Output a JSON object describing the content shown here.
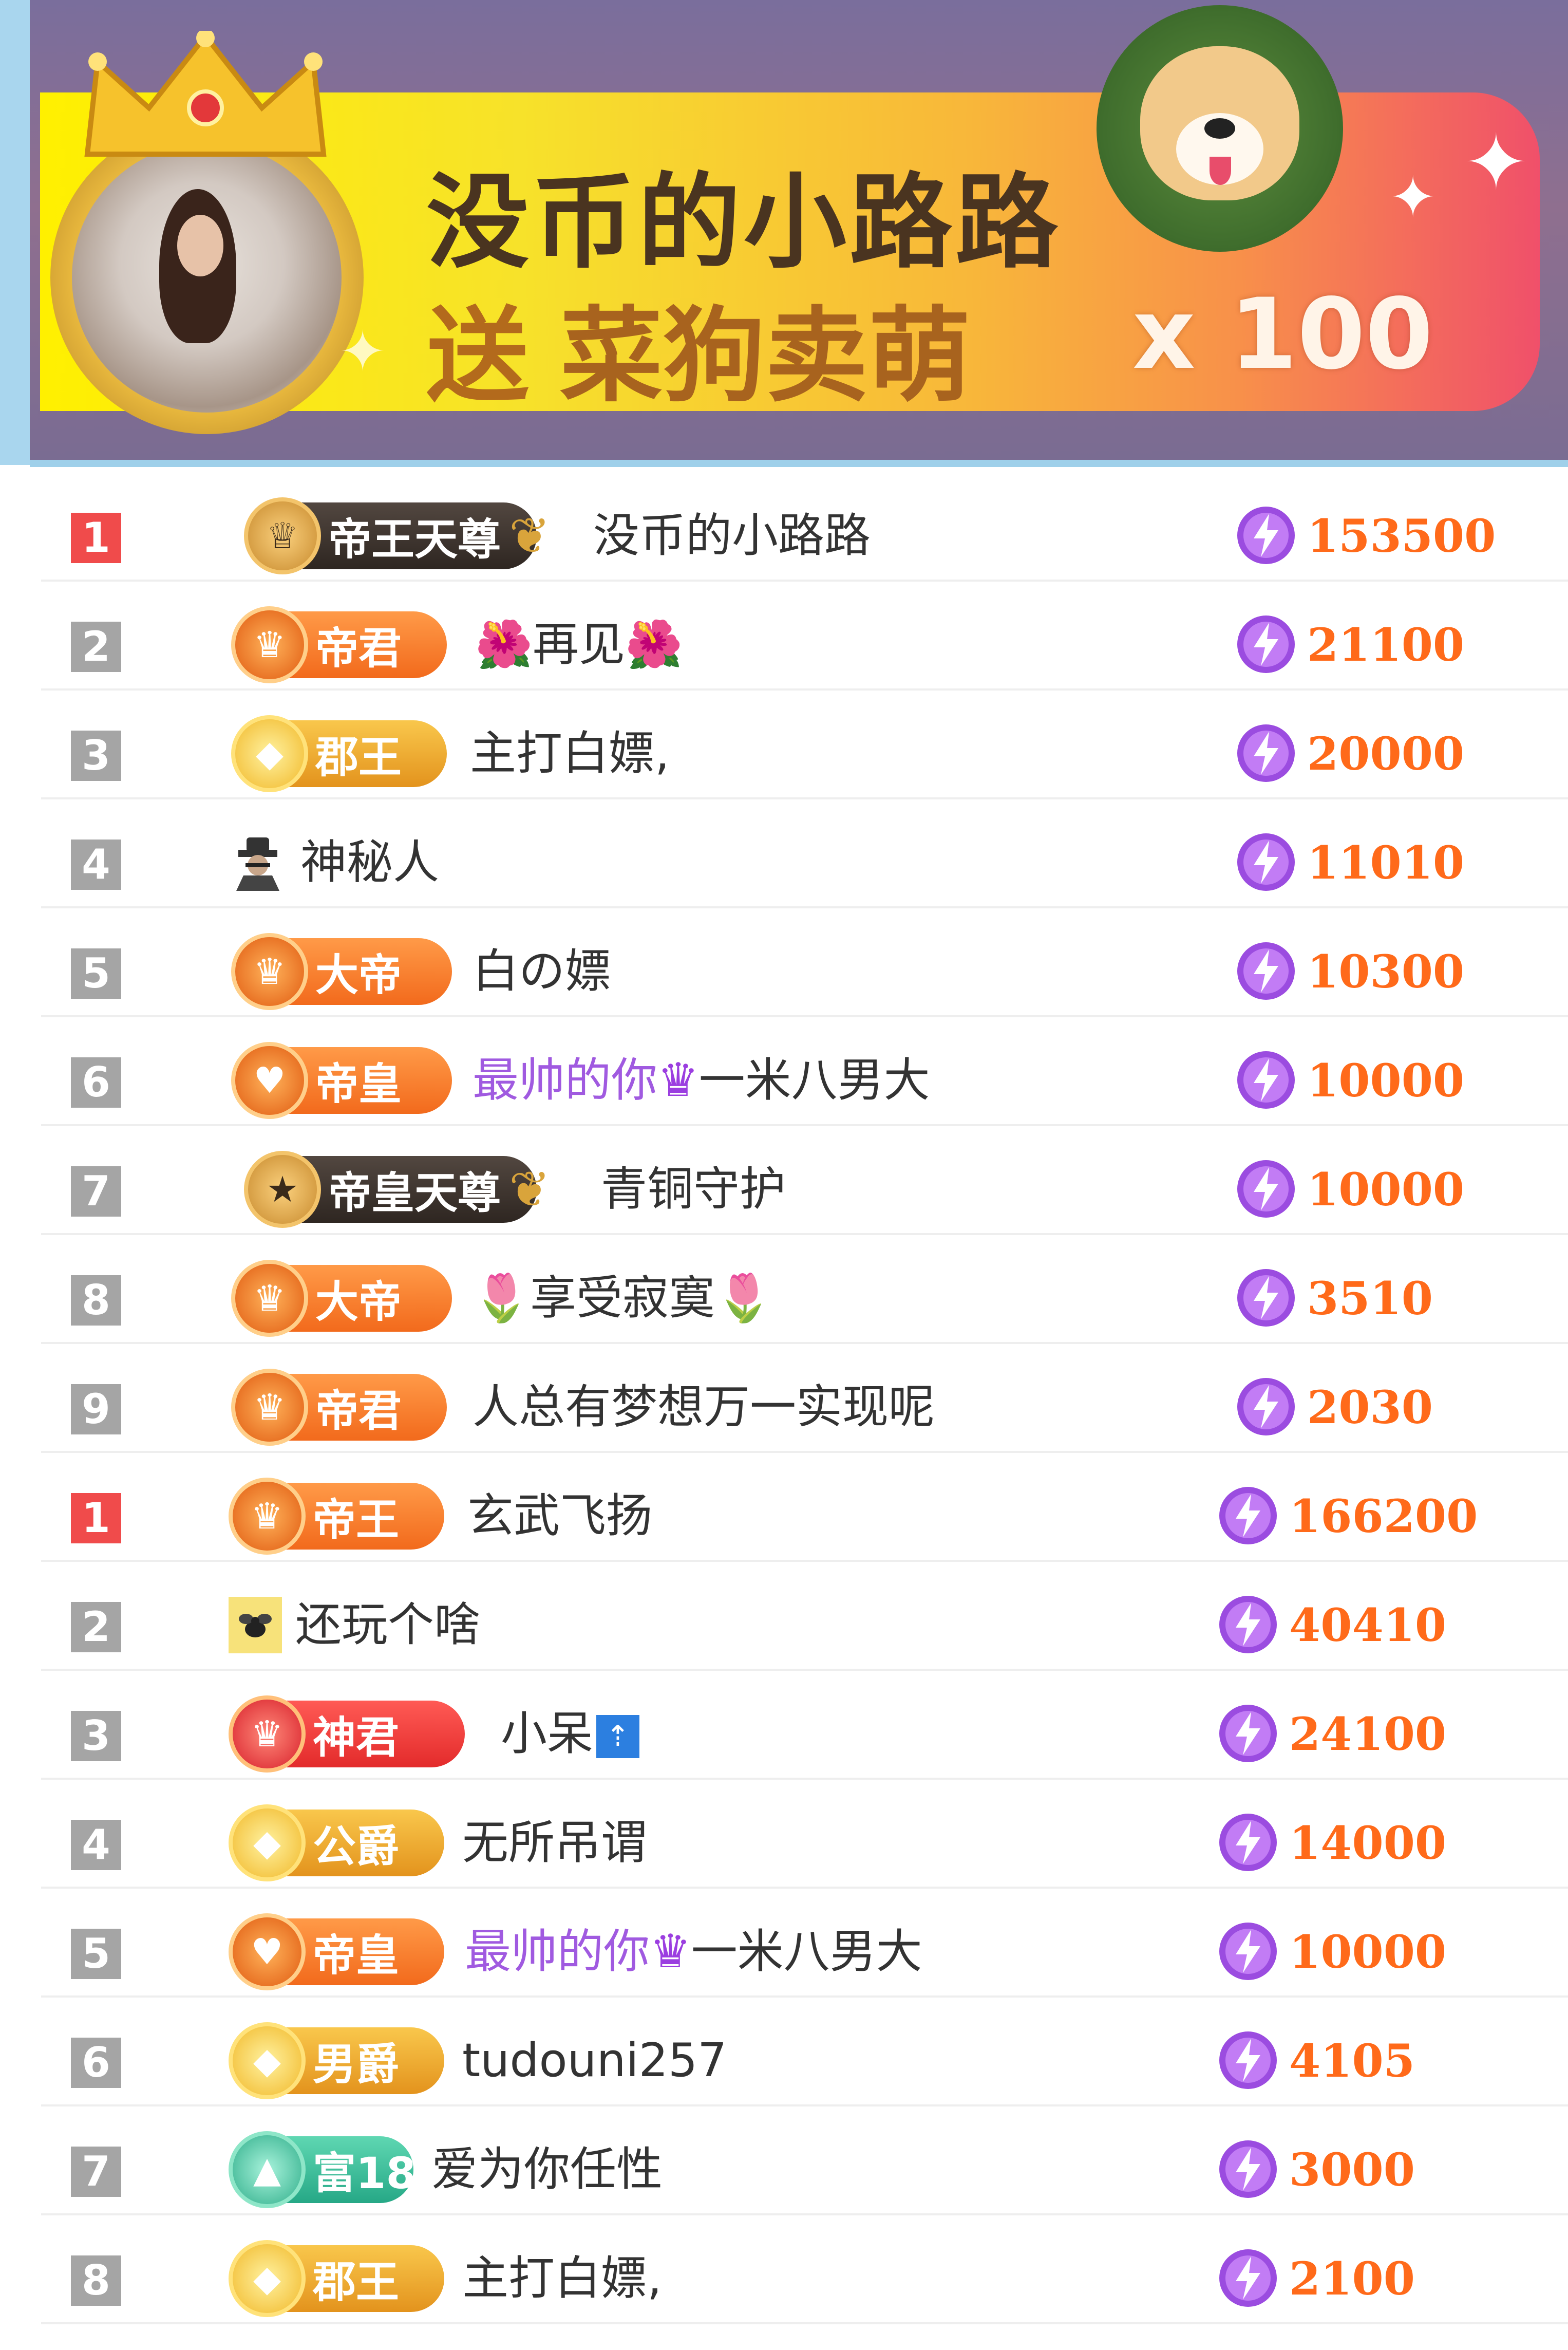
{
  "banner": {
    "user_name": "没币的小路路",
    "send_word": "送",
    "gift_name": "菜狗卖萌",
    "multiplier": "x 100"
  },
  "colors": {
    "rank_top": "#f04b4b",
    "rank_normal": "#a5a5a5",
    "score": "#ff6a1a",
    "username_highlight": "#a05ae0"
  },
  "leaderboard": [
    {
      "rank": "1",
      "badge": "帝王天尊",
      "name": "没币的小路路",
      "score": "153500"
    },
    {
      "rank": "2",
      "badge": "帝君",
      "name": "🌺再见🌺",
      "score": "21100"
    },
    {
      "rank": "3",
      "badge": "郡王",
      "name": "主打白嫖,",
      "score": "20000"
    },
    {
      "rank": "4",
      "badge": "",
      "icon": "spy-icon",
      "name": "神秘人",
      "score": "11010"
    },
    {
      "rank": "5",
      "badge": "大帝",
      "name": "白の嫖",
      "score": "10300"
    },
    {
      "rank": "6",
      "badge": "帝皇",
      "name_highlight": "最帅的你",
      "name_rest": "一米八男大",
      "score": "10000"
    },
    {
      "rank": "7",
      "badge": "帝皇天尊",
      "name": "青铜守护",
      "score": "10000"
    },
    {
      "rank": "8",
      "badge": "大帝",
      "name": "🌷享受寂寞🌷",
      "score": "3510"
    },
    {
      "rank": "9",
      "badge": "帝君",
      "name": "人总有梦想万一实现呢",
      "score": "2030"
    },
    {
      "rank": "1",
      "badge": "帝王",
      "name": "玄武飞扬",
      "score": "166200"
    },
    {
      "rank": "2",
      "badge": "",
      "icon": "bee-icon",
      "name": "还玩个啥",
      "score": "40410"
    },
    {
      "rank": "3",
      "badge": "神君",
      "name": "小呆",
      "score": "24100"
    },
    {
      "rank": "4",
      "badge": "公爵",
      "name": "无所吊谓",
      "score": "14000"
    },
    {
      "rank": "5",
      "badge": "帝皇",
      "name_highlight": "最帅的你",
      "name_rest": "一米八男大",
      "score": "10000"
    },
    {
      "rank": "6",
      "badge": "男爵",
      "name": "tudouni257",
      "score": "4105"
    },
    {
      "rank": "7",
      "badge": "富18",
      "name": "爱为你任性",
      "score": "3000"
    },
    {
      "rank": "8",
      "badge": "郡王",
      "name": "主打白嫖,",
      "score": "2100"
    }
  ]
}
